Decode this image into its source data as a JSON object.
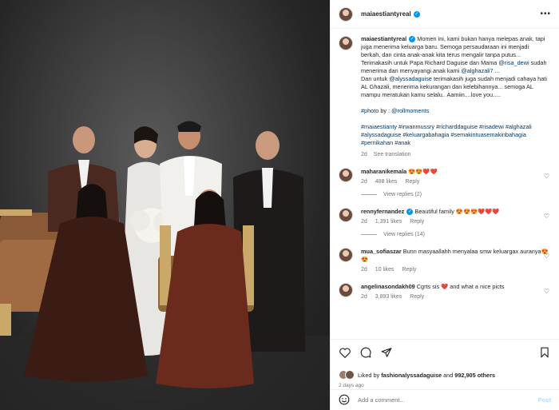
{
  "post": {
    "username": "maiaestiantyreal",
    "caption": {
      "intro": "Momen ini, kami bukan hanya melepas anak, tapi juga menerima keluarga baru. Semoga persaudaraan ini menjadi berkah, dan cinta anak-anak kita terus mengalir tanpa putus...",
      "thanks_prefix": "Terimakasih untuk Papa Richard Daguise dan Mama ",
      "mention_risa": "@risa_dewi",
      "thanks_mid": " sudah menerima dan menyayangi anak kami ",
      "mention_alghazali": "@alghazali7",
      "thanks_end": " ...",
      "and_prefix": "Dan untuk ",
      "mention_alyssa": "@alyssadaguise",
      "and_body": " terimakasih juga sudah menjadi cahaya hati AL Ghazali, menerima kekurangan dan kelebihannya... semoga AL mampu meratukan kamu selalu.. Aamiin....love you.....",
      "photo_tag": "#photo",
      "photo_by": " by : ",
      "photo_mention": "@rollmoments",
      "hashtags": "#maiaestianty #irwanmussry #richarddaguise #risadewi #alghazali #alyssadaguise #keluargabahagia #semakintuasemakinbahagia #pernikahan #anak",
      "time": "2d",
      "see_translation": "See translation"
    }
  },
  "comments": [
    {
      "username": "maharanikemala",
      "verified": false,
      "text": "😍😍❤️❤️",
      "time": "2d",
      "likes": "488 likes",
      "reply": "Reply",
      "view_replies": "View replies (2)"
    },
    {
      "username": "rennyfernandez",
      "verified": true,
      "text": "Beautiful family 😍😍😍❤️❤️❤️",
      "time": "2d",
      "likes": "1,391 likes",
      "reply": "Reply",
      "view_replies": "View replies (14)"
    },
    {
      "username": "mua_sofiaszar",
      "verified": false,
      "text": "Bunn masyaallahh menyalaa smw keluargax auranya😍😍",
      "time": "2d",
      "likes": "10 likes",
      "reply": "Reply",
      "view_replies": ""
    },
    {
      "username": "angelinasondakh09",
      "verified": false,
      "text": "Cgrts sis ❤️ and what a nice picts",
      "time": "2d",
      "likes": "3,893 likes",
      "reply": "Reply",
      "view_replies": ""
    }
  ],
  "actions": {
    "liked_by_prefix": "Liked by ",
    "liked_by_user": "fashionalyssadaguise",
    "liked_by_and": " and ",
    "liked_by_count": "992,905 others",
    "posted_ago": "2 days ago"
  },
  "add_comment": {
    "placeholder": "Add a comment...",
    "post_label": "Post"
  },
  "icons": {
    "more": "more-options-icon",
    "like": "heart-icon",
    "comment": "comment-icon",
    "share": "share-icon",
    "save": "bookmark-icon",
    "emoji": "emoji-icon"
  },
  "colors": {
    "verified": "#0095f6",
    "link": "#00376b",
    "muted": "#737373",
    "post_disabled": "#b3dbff"
  }
}
